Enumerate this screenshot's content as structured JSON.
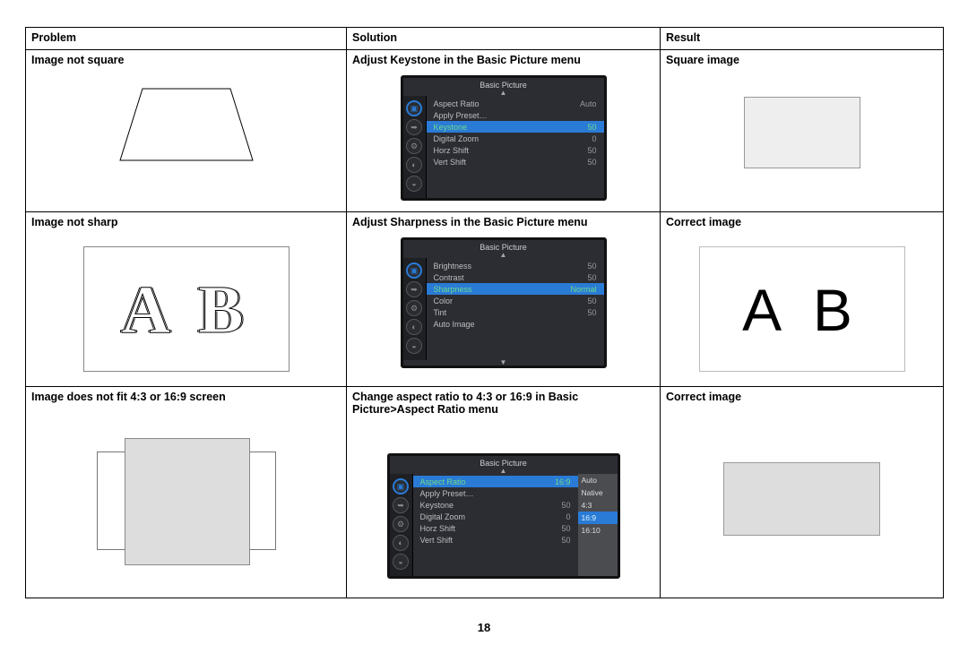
{
  "page_number": "18",
  "headers": {
    "c1": "Problem",
    "c2": "Solution",
    "c3": "Result"
  },
  "rows": [
    {
      "problem": "Image not square",
      "solution": "Adjust Keystone in the Basic Picture menu",
      "result": "Square image",
      "menu": {
        "title": "Basic Picture",
        "highlight_index": 2,
        "items": [
          {
            "k": "Aspect Ratio",
            "v": "Auto"
          },
          {
            "k": "Apply Preset…",
            "v": ""
          },
          {
            "k": "Keystone",
            "v": "50"
          },
          {
            "k": "Digital Zoom",
            "v": "0"
          },
          {
            "k": "Horz Shift",
            "v": "50"
          },
          {
            "k": "Vert Shift",
            "v": "50"
          }
        ]
      }
    },
    {
      "problem": "Image not sharp",
      "solution": "Adjust Sharpness in the Basic Picture menu",
      "result": "Correct image",
      "ab_text": "A B",
      "menu": {
        "title": "Basic Picture",
        "highlight_index": 2,
        "items": [
          {
            "k": "Brightness",
            "v": "50"
          },
          {
            "k": "Contrast",
            "v": "50"
          },
          {
            "k": "Sharpness",
            "v": "Normal"
          },
          {
            "k": "Color",
            "v": "50"
          },
          {
            "k": "Tint",
            "v": "50"
          },
          {
            "k": "Auto Image",
            "v": ""
          }
        ]
      }
    },
    {
      "problem": "Image does not fit 4:3 or 16:9 screen",
      "solution": "Change aspect ratio to 4:3 or 16:9 in Basic Picture>Aspect Ratio menu",
      "result": "Correct image",
      "menu": {
        "title": "Basic Picture",
        "highlight_index": 0,
        "items": [
          {
            "k": "Aspect Ratio",
            "v": "16:9"
          },
          {
            "k": "Apply Preset…",
            "v": ""
          },
          {
            "k": "Keystone",
            "v": "50"
          },
          {
            "k": "Digital Zoom",
            "v": "0"
          },
          {
            "k": "Horz Shift",
            "v": "50"
          },
          {
            "k": "Vert Shift",
            "v": "50"
          }
        ],
        "submenu": {
          "selected_index": 3,
          "options": [
            "Auto",
            "Native",
            "4:3",
            "16:9",
            "16:10"
          ]
        }
      }
    }
  ]
}
